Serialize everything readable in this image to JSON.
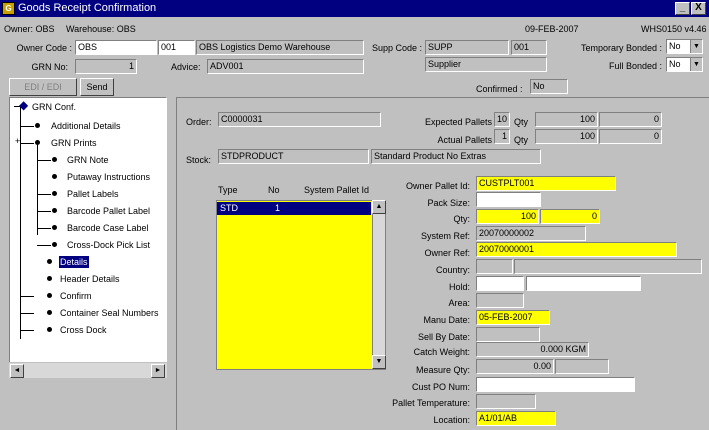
{
  "window": {
    "title": "Goods Receipt Confirmation",
    "app_icon": "app-icon",
    "minimize": "_",
    "close": "X"
  },
  "header": {
    "owner_label": "Owner: OBS",
    "warehouse_label": "Warehouse: OBS",
    "date": "09-FEB-2007",
    "version": "WHS0150  v4.46"
  },
  "form": {
    "owner_code_label": "Owner Code :",
    "owner_code": "OBS",
    "site_code": "001",
    "site_name": "OBS Logistics Demo Warehouse",
    "supp_code_label": "Supp Code :",
    "supp_code": "SUPP",
    "supp_site": "001",
    "supp_name": "Supplier",
    "temp_bonded_label": "Temporary Bonded :",
    "temp_bonded": "No",
    "full_bonded_label": "Full Bonded :",
    "full_bonded": "No",
    "grn_no_label": "GRN No:",
    "grn_no": "1",
    "advice_label": "Advice:",
    "advice": "ADV001",
    "confirmed_label": "Confirmed :",
    "confirmed": "No"
  },
  "buttons": {
    "edi": "EDI / EDI",
    "send": "Send"
  },
  "tree": {
    "root": "GRN Conf.",
    "items": [
      "Additional Details",
      "GRN Prints",
      "GRN Note",
      "Putaway Instructions",
      "Pallet Labels",
      "Barcode Pallet Label",
      "Barcode Case Label",
      "Cross-Dock Pick List",
      "Details",
      "Header Details",
      "Confirm",
      "Container Seal Numbers",
      "Cross Dock"
    ],
    "scroll_left": "◄",
    "scroll_right": "►"
  },
  "detail": {
    "order_label": "Order:",
    "order": "C0000031",
    "expected_pallets_label": "Expected Pallets",
    "expected_pallets": "10",
    "expected_qty_label": "Qty",
    "expected_qty": "100",
    "expected_extra": "0",
    "actual_pallets_label": "Actual Pallets",
    "actual_pallets": "1",
    "actual_qty_label": "Qty",
    "actual_qty": "100",
    "actual_extra": "0",
    "stock_label": "Stock:",
    "stock_code": "STDPRODUCT",
    "stock_desc": "Standard Product No Extras"
  },
  "pallet_list": {
    "columns": [
      "Type",
      "No",
      "System Pallet Id"
    ],
    "rows": [
      {
        "type": "STD",
        "no": "1",
        "system_pallet_id": ""
      }
    ]
  },
  "pallet": {
    "owner_pallet_id_label": "Owner Pallet Id:",
    "owner_pallet_id": "CUSTPLT001",
    "pack_size_label": "Pack Size:",
    "pack_size": "",
    "qty_label": "Qty:",
    "qty": "100",
    "qty2": "0",
    "system_ref_label": "System Ref:",
    "system_ref": "20070000002",
    "owner_ref_label": "Owner Ref:",
    "owner_ref": "20070000001",
    "country_label": "Country:",
    "hold_label": "Hold:",
    "area_label": "Area:",
    "manu_date_label": "Manu Date:",
    "manu_date": "05-FEB-2007",
    "sell_by_date_label": "Sell By Date:",
    "catch_weight_label": "Catch Weight:",
    "catch_weight": "0.000 KGM",
    "measure_qty_label": "Measure Qty:",
    "measure_qty": "0.00",
    "cust_po_label": "Cust PO Num:",
    "pallet_temp_label": "Pallet Temperature:",
    "location_label": "Location:",
    "location": "A1/01/AB"
  }
}
